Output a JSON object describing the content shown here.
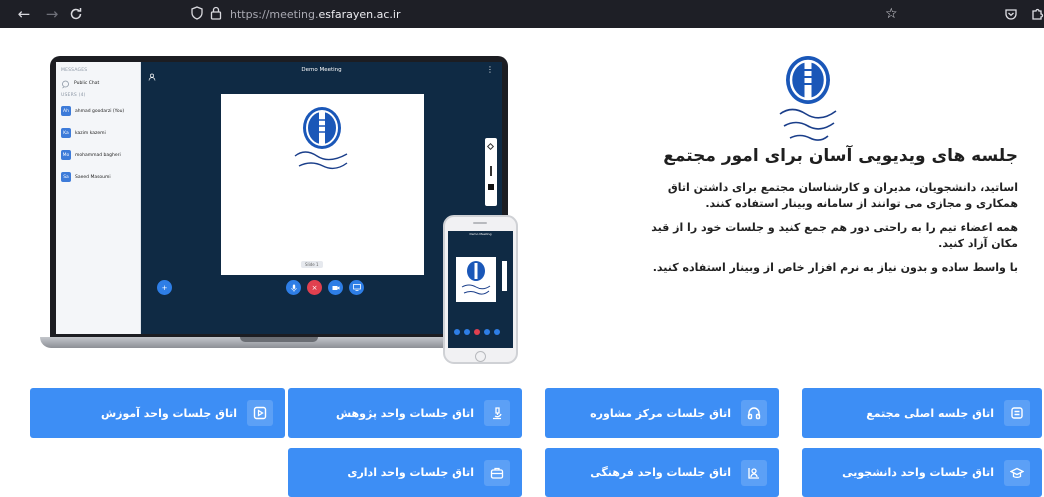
{
  "browser": {
    "url_prefix": "https://meeting.",
    "url_domain": "esfarayen.ac.ir"
  },
  "laptop": {
    "messages_heading": "MESSAGES",
    "public_chat": "Public Chat",
    "users_heading": "USERS (4)",
    "users": [
      {
        "initials": "Ah",
        "name": "ahmad goodarzi (You)",
        "color": "#3d7bd9"
      },
      {
        "initials": "Ka",
        "name": "kazim kazemi",
        "color": "#3d7bd9"
      },
      {
        "initials": "Mo",
        "name": "mohammad bagheri",
        "color": "#3d7bd9"
      },
      {
        "initials": "Sa",
        "name": "Saeed Masoumi",
        "color": "#3d7bd9"
      }
    ],
    "meeting_title": "Demo Meeting",
    "slide_pager": "Slide 1"
  },
  "hero": {
    "title": "جلسه های ویدیویی آسان برای امور مجتمع",
    "paragraphs": [
      "اساتید، دانشجویان، مدیران و کارشناسان مجتمع برای داشتن اتاق همکاری و مجازی می توانند از سامانه وبینار استفاده کنند.",
      "همه اعضاء تیم را به راحتی دور هم جمع کنید و جلسات خود را از قید مکان آزاد کنید.",
      "با واسط ساده و بدون نیاز به نرم افزار خاص از وبینار استفاده کنید."
    ]
  },
  "rooms": {
    "main": "اتاق جلسه اصلی مجتمع",
    "counseling": "اتاق جلسات مرکز مشاوره",
    "research": "اتاق جلسات واحد پژوهش",
    "education": "اتاق جلسات واحد آموزش",
    "student": "اتاق جلسات واحد دانشجویی",
    "cultural": "اتاق جلسات واحد فرهنگی",
    "admin": "اتاق جلسات واحد اداری"
  },
  "colors": {
    "button_blue": "#3d8ef5",
    "browser_bar": "#1e1f26",
    "meeting_bg": "#0f2a44"
  }
}
